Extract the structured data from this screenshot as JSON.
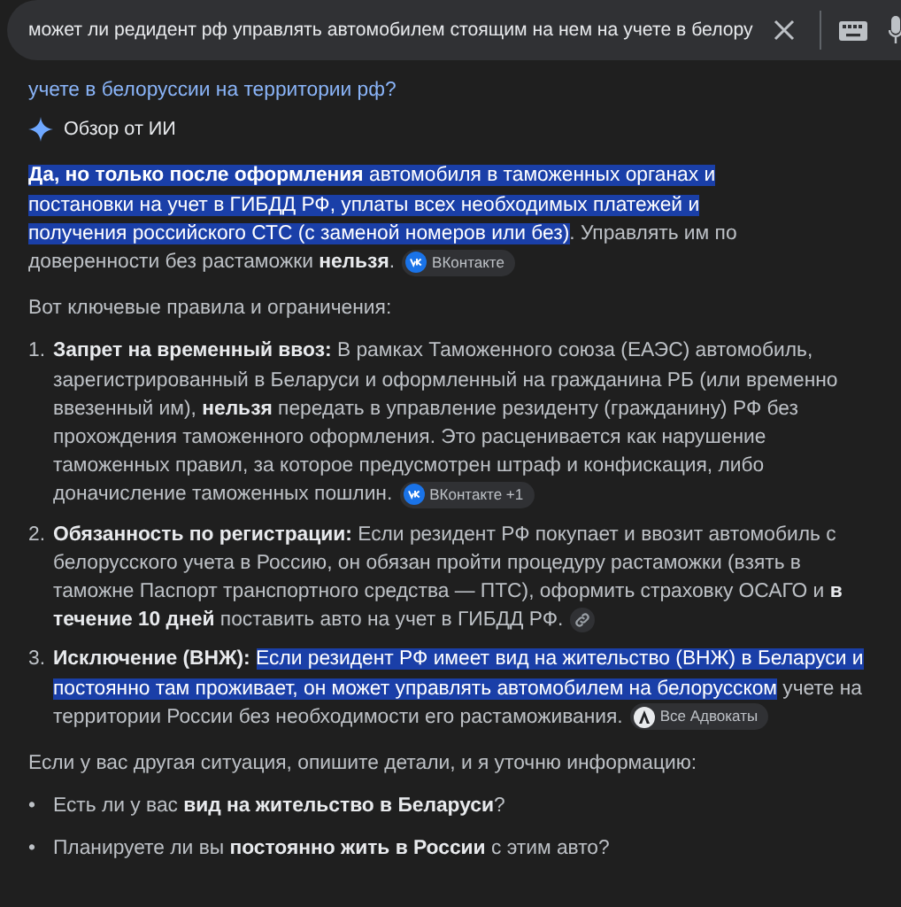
{
  "search": {
    "value": "может ли редидент рф управлять автомобилем стоящим на нем на учете в белору"
  },
  "query_tail": "учете в белоруссии на территории рф?",
  "ai_overview": {
    "label": "Обзор от ИИ"
  },
  "intro": {
    "segments": [
      {
        "text": "**Да, но только после оформления** автомобиля в таможенных органах и постановки на учет в ГИБДД РФ, уплаты всех необходимых платежей и получения российского СТС (с заменой номеров или без)",
        "highlighted": true
      },
      {
        "text": ". Управлять им по доверенности без растаможки **нельзя**.",
        "highlighted": false
      }
    ],
    "chip": {
      "kind": "vk",
      "label": "ВКонтакте"
    }
  },
  "lead": "Вот ключевые правила и ограничения:",
  "items": [
    {
      "marker": "1.",
      "segments": [
        {
          "text": "**Запрет на временный ввоз:** В рамках Таможенного союза (ЕАЭС) автомобиль, зарегистрированный в Беларуси и оформленный на гражданина РБ (или временно ввезенный им), **нельзя** передать в управление резиденту (гражданину) РФ без прохождения таможенного оформления. Это расценивается как нарушение таможенных правил, за которое предусмотрен штраф и конфискация, либо доначисление таможенных пошлин.",
          "highlighted": false
        }
      ],
      "chip": {
        "kind": "vk",
        "label": "ВКонтакте +1"
      }
    },
    {
      "marker": "2.",
      "segments": [
        {
          "text": "**Обязанность по регистрации:** Если резидент РФ покупает и ввозит автомобиль с белорусского учета в Россию, он обязан пройти процедуру растаможки (взять в таможне Паспорт транспортного средства — ПТС), оформить страховку ОСАГО и **в течение 10 дней** поставить авто на учет в ГИБДД РФ.",
          "highlighted": false
        }
      ],
      "chip": {
        "kind": "link"
      }
    },
    {
      "marker": "3.",
      "segments": [
        {
          "text": "**Исключение (ВНЖ):** ",
          "highlighted": false
        },
        {
          "text": "Если резидент РФ имеет вид на жительство (ВНЖ) в Беларуси и постоянно там проживает, он может управлять автомобилем на белорусском",
          "highlighted": true
        },
        {
          "text": " учете на территории России без необходимости его растаможивания.",
          "highlighted": false
        }
      ],
      "chip": {
        "kind": "lawyers",
        "label": "Все Адвокаты"
      }
    }
  ],
  "closing": "Если у вас другая ситуация, опишите детали, и я уточню информацию:",
  "bullets": [
    {
      "marker": "•",
      "text": "Есть ли у вас **вид на жительство в Беларуси**?"
    },
    {
      "marker": "•",
      "text": "Планируете ли вы **постоянно жить в России** с этим авто?"
    }
  ]
}
